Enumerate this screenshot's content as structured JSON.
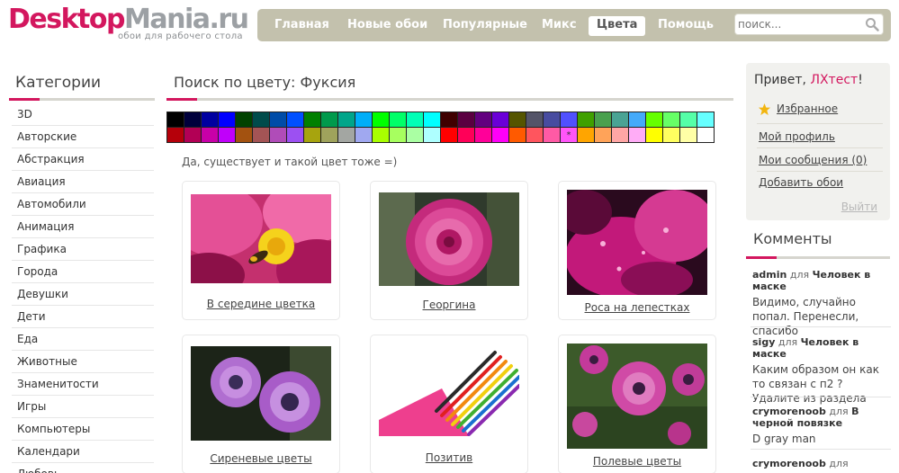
{
  "logo": {
    "part1": "Desktop",
    "part2": "Mania",
    "part3": ".ru",
    "tagline": "обои для рабочего стола"
  },
  "nav": {
    "items": [
      {
        "label": "Главная"
      },
      {
        "label": "Новые обои"
      },
      {
        "label": "Популярные"
      },
      {
        "label": "Микс"
      },
      {
        "label": "Цвета",
        "active": true
      },
      {
        "label": "Помощь"
      }
    ],
    "search_placeholder": "поиск...",
    "search_icon": "magnifier-icon"
  },
  "categories": {
    "title": "Категории",
    "items": [
      "3D",
      "Авторские",
      "Абстракция",
      "Авиация",
      "Автомобили",
      "Анимация",
      "Графика",
      "Города",
      "Девушки",
      "Дети",
      "Еда",
      "Животные",
      "Знаменитости",
      "Игры",
      "Компьютеры",
      "Календари",
      "Любовь"
    ]
  },
  "main": {
    "title": "Поиск по цвету: Фуксия",
    "note": "Да, существует и такой цвет тоже =)",
    "palette": {
      "row1": [
        "#000000",
        "#00003c",
        "#0000a0",
        "#0000ff",
        "#004200",
        "#004b4b",
        "#004ca8",
        "#0050ff",
        "#008000",
        "#009a4c",
        "#00a58a",
        "#00aef8",
        "#00ff00",
        "#00ff68",
        "#00ffb6",
        "#00ffff",
        "#3f0000",
        "#5a0041",
        "#62007f",
        "#6a00d7",
        "#555500",
        "#545468",
        "#484ca0",
        "#5050ff",
        "#40a000",
        "#49a04e",
        "#4aa394",
        "#44aafa",
        "#66ff00",
        "#66ff66",
        "#55ffa8",
        "#66ffff"
      ],
      "row2": [
        "#b5000a",
        "#b20055",
        "#c800a8",
        "#c000fa",
        "#a35210",
        "#a45455",
        "#b04cb8",
        "#9c50f2",
        "#a7a40e",
        "#9fa35c",
        "#a3a6a2",
        "#a0a8f0",
        "#a9ff00",
        "#a7ff5f",
        "#aaffa3",
        "#aeffff",
        "#ff0000",
        "#ff0058",
        "#ff0099",
        "#ff00f8",
        "#ff5a00",
        "#ff555e",
        "#ff5aa5",
        "#ff55f9",
        "#ffa500",
        "#ffa359",
        "#ffa6a5",
        "#ffacf6",
        "#ffff00",
        "#ffff60",
        "#ffffa6",
        "#ffffff"
      ],
      "selected_mark": "*"
    },
    "wallpapers": [
      {
        "caption": "В середине цветка"
      },
      {
        "caption": "Георгина"
      },
      {
        "caption": "Роса на лепестках"
      },
      {
        "caption": "Сиреневые цветы"
      },
      {
        "caption": "Позитив"
      },
      {
        "caption": "Полевые цветы"
      }
    ]
  },
  "user": {
    "greeting": "Привет, ",
    "username": "ЛХтест",
    "exclaim": "!",
    "links": [
      "Избранное",
      "Мой профиль",
      "Мои сообщения (0)",
      "Добавить обои"
    ],
    "logout": "Выйти"
  },
  "comments": {
    "title": "Комменты",
    "items": [
      {
        "author": "admin",
        "dlya": " для ",
        "target": "Человек в маске",
        "text": "Видимо, случайно попал. Перенесли, спасибо"
      },
      {
        "author": "sigy",
        "dlya": " для ",
        "target": "Человек в маске",
        "text": "Каким образом он как то связан с п2 ? Удалите из раздела"
      },
      {
        "author": "crymorenoob",
        "dlya": " для ",
        "target": "В черной повязке",
        "text": "D gray man"
      },
      {
        "author": "crymorenoob",
        "dlya": " для ",
        "target": "",
        "text": ""
      }
    ]
  },
  "colors": {
    "brand_pink": "#d3175e",
    "nav_bg": "#c3c1ad",
    "grey_bar": "#d6d5ce"
  }
}
